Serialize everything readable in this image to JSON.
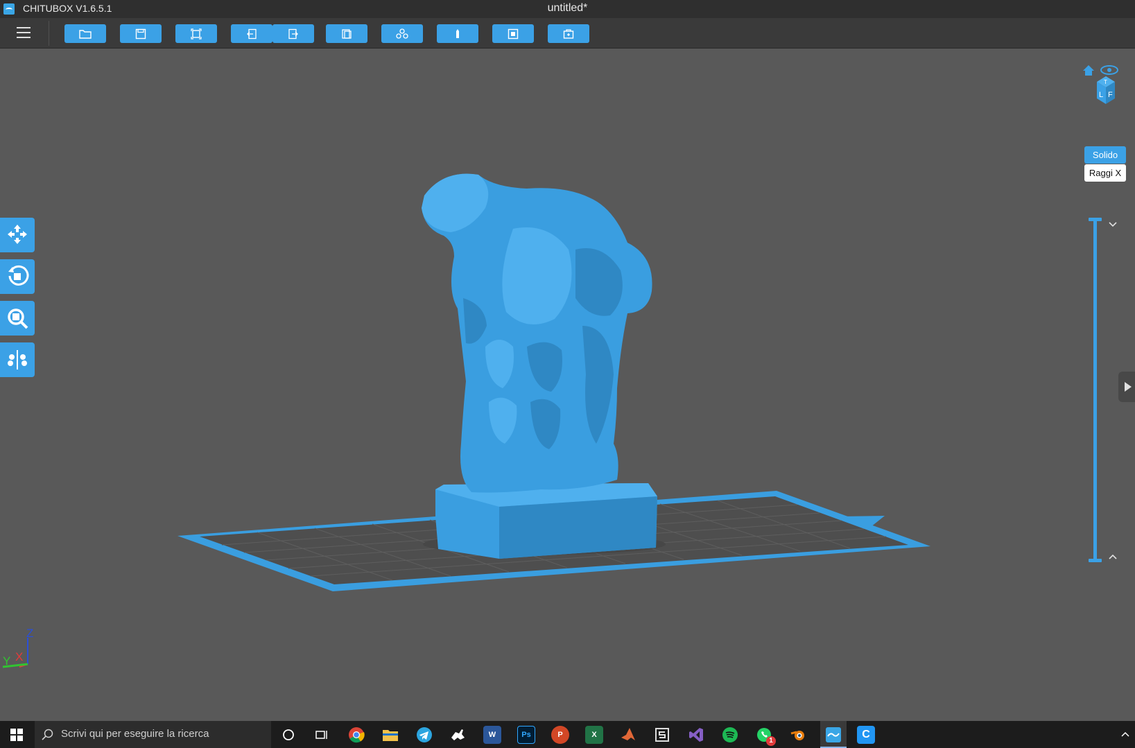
{
  "window": {
    "app_name": "CHITUBOX V1.6.5.1",
    "doc_title": "untitled*"
  },
  "toolbar": {
    "menu_icon": "hamburger-icon",
    "buttons": [
      {
        "name": "open-file-button",
        "icon": "folder-open-icon"
      },
      {
        "name": "save-button",
        "icon": "save-icon"
      },
      {
        "name": "screenshot-button",
        "icon": "crop-icon"
      },
      {
        "name": "undo-button",
        "icon": "undo-icon"
      },
      {
        "name": "redo-button",
        "icon": "redo-icon"
      },
      {
        "name": "copy-button",
        "icon": "copy-icon"
      },
      {
        "name": "arrange-button",
        "icon": "arrange-icon"
      },
      {
        "name": "supports-button",
        "icon": "support-icon"
      },
      {
        "name": "hollow-button",
        "icon": "hollow-icon"
      },
      {
        "name": "settings-button",
        "icon": "settings-icon"
      }
    ]
  },
  "left_tools": [
    {
      "name": "move-tool",
      "icon": "move-icon"
    },
    {
      "name": "rotate-tool",
      "icon": "rotate-icon"
    },
    {
      "name": "scale-tool",
      "icon": "scale-icon"
    },
    {
      "name": "mirror-tool",
      "icon": "mirror-icon"
    }
  ],
  "view_mode": {
    "solid_label": "Solido",
    "xray_label": "Raggi X",
    "selected": "Solido"
  },
  "axes": {
    "z": "Z",
    "x": "X",
    "y": "Y"
  },
  "taskbar": {
    "search_placeholder": "Scrivi qui per eseguire la ricerca",
    "whatsapp_badge": "1"
  },
  "colors": {
    "accent": "#3ba1e6",
    "model": "#3a9ee0",
    "viewport": "#595959"
  }
}
